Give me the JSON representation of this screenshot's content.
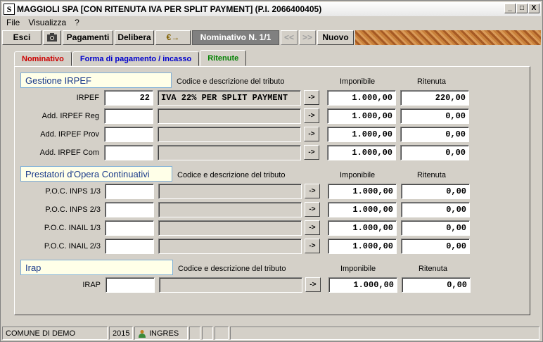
{
  "window": {
    "icon": "S",
    "title": "MAGGIOLI SPA [CON RITENUTA IVA PER SPLIT PAYMENT] (P.I. 2066400405)",
    "minimize": "_",
    "maximize": "□",
    "close": "X"
  },
  "menu": [
    "File",
    "Visualizza",
    "?"
  ],
  "toolbar": {
    "esci": "Esci",
    "camera_icon": "camera-icon",
    "pagamenti": "Pagamenti",
    "delibera": "Delibera",
    "euro_icon": "€→",
    "nominativo": "Nominativo N. 1/1",
    "prev": "<<",
    "next": ">>",
    "nuovo": "Nuovo"
  },
  "tabs": [
    {
      "label": "Nominativo",
      "color": "#cc0000"
    },
    {
      "label": "Forma di pagamento / incasso",
      "color": "#0000cc"
    },
    {
      "label": "Ritenute",
      "color": "#008000"
    }
  ],
  "headers": {
    "codice": "Codice e descrizione del tributo",
    "imponibile": "Imponibile",
    "ritenuta": "Ritenuta"
  },
  "sections": {
    "irpef": {
      "title": "Gestione IRPEF",
      "rows": [
        {
          "label": "IRPEF",
          "code": "22",
          "desc": "IVA 22% PER SPLIT PAYMENT",
          "imponibile": "1.000,00",
          "ritenuta": "220,00"
        },
        {
          "label": "Add. IRPEF Reg",
          "code": "",
          "desc": "",
          "imponibile": "1.000,00",
          "ritenuta": "0,00"
        },
        {
          "label": "Add. IRPEF Prov",
          "code": "",
          "desc": "",
          "imponibile": "1.000,00",
          "ritenuta": "0,00"
        },
        {
          "label": "Add. IRPEF Com",
          "code": "",
          "desc": "",
          "imponibile": "1.000,00",
          "ritenuta": "0,00"
        }
      ]
    },
    "poc": {
      "title": "Prestatori d'Opera Continuativi",
      "rows": [
        {
          "label": "P.O.C. INPS 1/3",
          "code": "",
          "desc": "",
          "imponibile": "1.000,00",
          "ritenuta": "0,00"
        },
        {
          "label": "P.O.C. INPS 2/3",
          "code": "",
          "desc": "",
          "imponibile": "1.000,00",
          "ritenuta": "0,00"
        },
        {
          "label": "P.O.C. INAIL 1/3",
          "code": "",
          "desc": "",
          "imponibile": "1.000,00",
          "ritenuta": "0,00"
        },
        {
          "label": "P.O.C. INAIL 2/3",
          "code": "",
          "desc": "",
          "imponibile": "1.000,00",
          "ritenuta": "0,00"
        }
      ]
    },
    "irap": {
      "title": "Irap",
      "rows": [
        {
          "label": "IRAP",
          "code": "",
          "desc": "",
          "imponibile": "1.000,00",
          "ritenuta": "0,00"
        }
      ]
    }
  },
  "arrow_label": "->",
  "status": {
    "comune": "COMUNE DI DEMO",
    "anno": "2015",
    "user_icon": "user-icon",
    "utente": "INGRES"
  }
}
